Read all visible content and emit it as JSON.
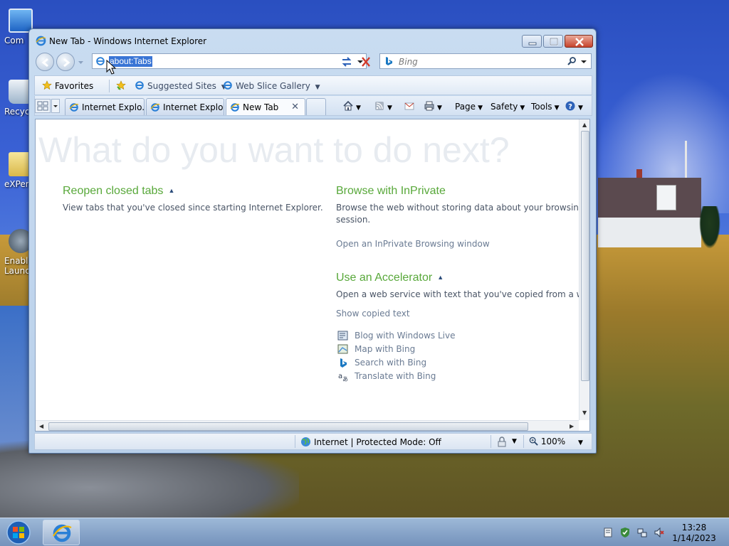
{
  "desktop": {
    "icons": [
      {
        "label": "Com"
      },
      {
        "label": "Recyc"
      },
      {
        "label": "eXPer"
      },
      {
        "label": "Enable",
        "label2": "Launc"
      }
    ]
  },
  "window": {
    "title": "New Tab - Windows Internet Explorer"
  },
  "address": {
    "url": "about:Tabs"
  },
  "search": {
    "placeholder": "Bing"
  },
  "favorites_bar": {
    "favorites_label": "Favorites",
    "suggested_label": "Suggested Sites",
    "webslice_label": "Web Slice Gallery"
  },
  "tabs": [
    {
      "label": "Internet Explo..."
    },
    {
      "label": "Internet Explo..."
    },
    {
      "label": "New Tab"
    }
  ],
  "commandbar": {
    "page": "Page",
    "safety": "Safety",
    "tools": "Tools"
  },
  "content": {
    "heading": "What do you want to do next?",
    "reopen": {
      "title": "Reopen closed tabs",
      "desc": "View tabs that you've closed since starting Internet Explorer."
    },
    "inprivate": {
      "title": "Browse with InPrivate",
      "desc1": "Browse the web without storing data about your browsing",
      "desc2": "session.",
      "link": "Open an InPrivate Browsing window"
    },
    "accelerator": {
      "title": "Use an Accelerator",
      "desc": "Open a web service with text that you've copied from a we",
      "link": "Show copied text",
      "items": [
        {
          "label": "Blog with Windows Live"
        },
        {
          "label": "Map with Bing"
        },
        {
          "label": "Search with Bing"
        },
        {
          "label": "Translate with Bing"
        }
      ]
    }
  },
  "status": {
    "zone": "Internet | Protected Mode: Off",
    "zoom": "100%"
  },
  "taskbar": {
    "time": "13:28",
    "date": "1/14/2023"
  },
  "colors": {
    "accent_green": "#58a83a",
    "link_gray": "#6a7b93",
    "selection_blue": "#3a75d5"
  }
}
